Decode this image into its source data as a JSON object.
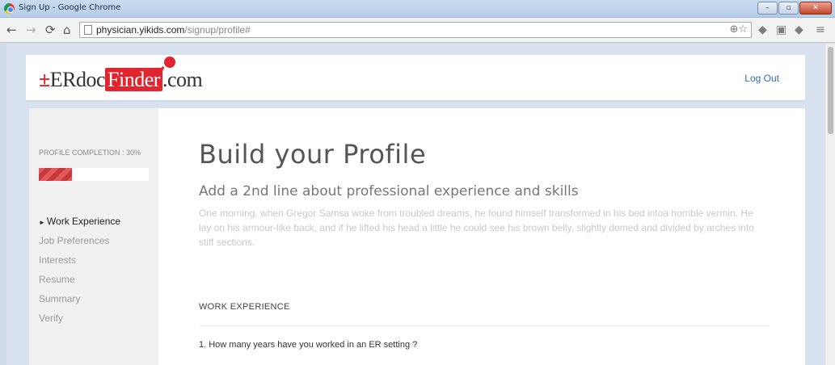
{
  "window": {
    "title": "Sign Up - Google Chrome",
    "controls": [
      "–",
      "▫",
      "✕"
    ]
  },
  "browser": {
    "url_host": "physician.yikids.com",
    "url_path": "/signup/profile#"
  },
  "site": {
    "logo_prefix": "±",
    "logo_erdoc": "ERdoc",
    "logo_finder": "Finder",
    "logo_suffix": ".com",
    "logout_label": "Log Out"
  },
  "sidebar": {
    "completion_label": "PROFILE COMPLETION : 30%",
    "completion_percent": 30,
    "steps": [
      {
        "label": "Work Experience",
        "active": true
      },
      {
        "label": "Job Preferences",
        "active": false
      },
      {
        "label": "Interests",
        "active": false
      },
      {
        "label": "Resume",
        "active": false
      },
      {
        "label": "Summary",
        "active": false
      },
      {
        "label": "Verify",
        "active": false
      }
    ]
  },
  "main": {
    "title": "Build your Profile",
    "subtitle": "Add a 2nd line about professional experience and skills",
    "body_text": "One morning, when Gregor Samsa woke from troubled dreams, he found himself transformed in his bed intoa horrible vermin. He lay on his armour-like back, and if he lifted his head a little he could see his brown belly, slightly domed and divided by arches into stiff sections.",
    "section_title": "WORK EXPERIENCE",
    "question": "1. How many years have you worked in an ER setting ?"
  },
  "colors": {
    "brand_red": "#e0252e",
    "link_blue": "#2e6fb6"
  }
}
